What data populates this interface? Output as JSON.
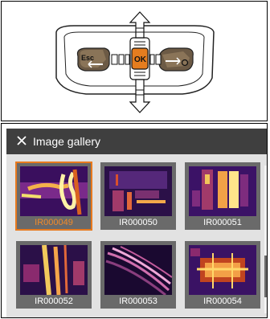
{
  "device": {
    "keys": {
      "esc_label": "Esc",
      "ok_label": "OK",
      "right_key_icon": "camera-icon"
    },
    "arrows": [
      "up-arrow-icon",
      "down-arrow-icon",
      "left-arrow-icon",
      "right-arrow-icon"
    ]
  },
  "screen": {
    "header": {
      "close_icon": "close-icon",
      "title": "Image gallery"
    },
    "images": [
      {
        "label": "IR000049",
        "selected": true
      },
      {
        "label": "IR000050",
        "selected": false
      },
      {
        "label": "IR000051",
        "selected": false
      },
      {
        "label": "IR000052",
        "selected": false
      },
      {
        "label": "IR000053",
        "selected": false
      },
      {
        "label": "IR000054",
        "selected": false
      }
    ]
  },
  "colors": {
    "accent": "#e87a1e",
    "header_bg": "#3f3f3f",
    "gallery_bg": "#e2e2e2",
    "ok_key": "#e57d1f"
  }
}
